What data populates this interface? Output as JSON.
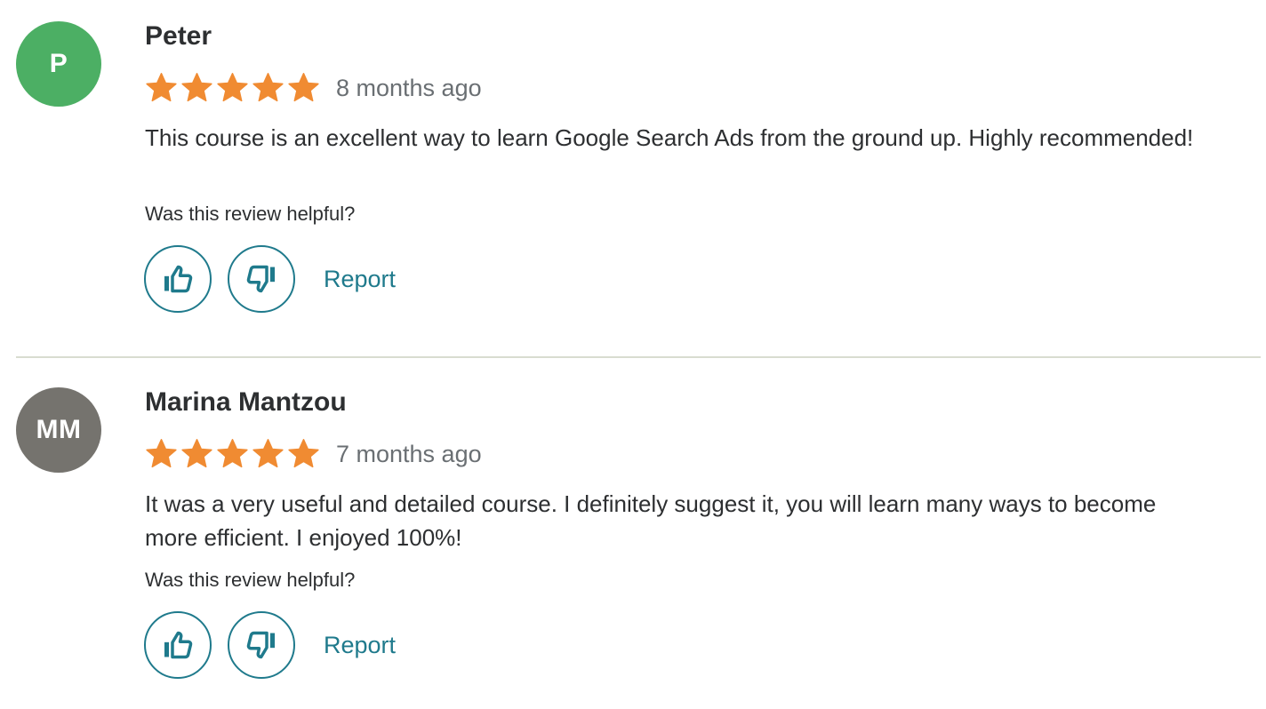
{
  "colors": {
    "star": "#f08b32",
    "accent": "#1f7a8c",
    "divider": "#d8dcd0"
  },
  "reviews": [
    {
      "initials": "P",
      "avatar_color": "#4caf64",
      "name": "Peter",
      "rating": 5,
      "max_rating": 5,
      "date": "8 months ago",
      "text": "This course is an excellent way to learn Google Search Ads from the ground up. Highly recommended!",
      "helpful_prompt": "Was this review helpful?",
      "thumbs_up_icon": "thumbs-up-icon",
      "thumbs_down_icon": "thumbs-down-icon",
      "report_label": "Report"
    },
    {
      "initials": "MM",
      "avatar_color": "#75736e",
      "name": "Marina Mantzou",
      "rating": 5,
      "max_rating": 5,
      "date": "7 months ago",
      "text": "It was a very useful and detailed course. I definitely suggest it, you will learn many ways to become more efficient. I enjoyed 100%!",
      "helpful_prompt": "Was this review helpful?",
      "thumbs_up_icon": "thumbs-up-icon",
      "thumbs_down_icon": "thumbs-down-icon",
      "report_label": "Report"
    }
  ]
}
